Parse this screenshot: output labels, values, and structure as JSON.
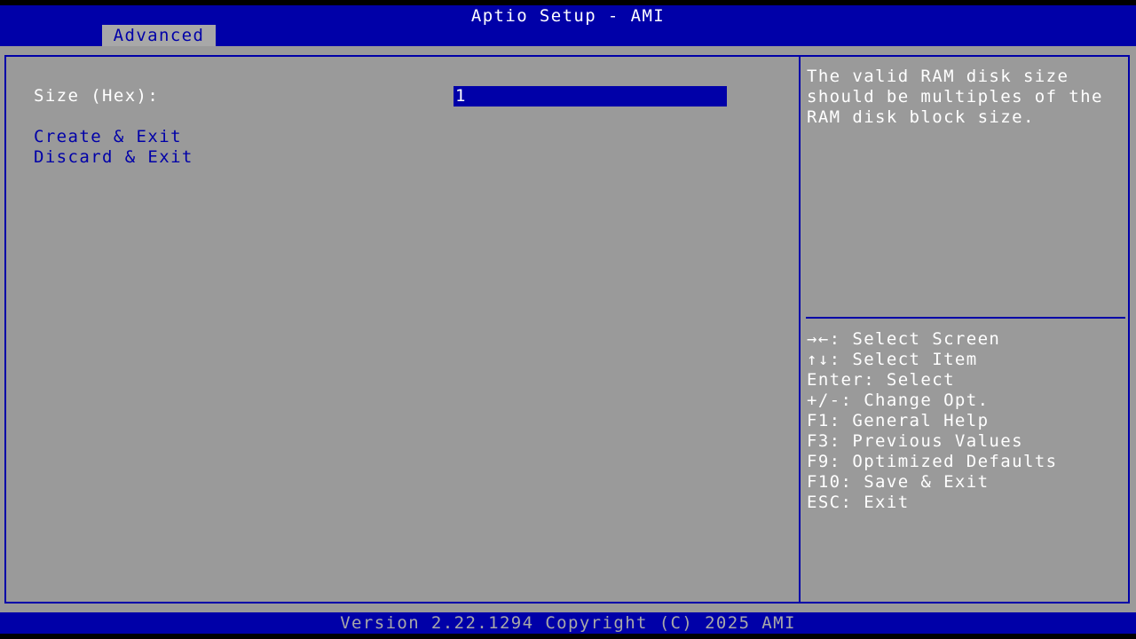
{
  "header": {
    "title": "Aptio Setup - AMI",
    "active_tab": "Advanced"
  },
  "form": {
    "size_label": "Size (Hex):",
    "size_value": "1",
    "actions": [
      {
        "label": "Create & Exit"
      },
      {
        "label": "Discard & Exit"
      }
    ]
  },
  "help": {
    "text": "The valid RAM disk size\nshould be multiples of the\nRAM disk block size."
  },
  "keys": [
    {
      "text": "→←: Select Screen"
    },
    {
      "text": "↑↓: Select Item"
    },
    {
      "text": "Enter: Select"
    },
    {
      "text": "+/-: Change Opt."
    },
    {
      "text": "F1: General Help"
    },
    {
      "text": "F3: Previous Values"
    },
    {
      "text": "F9: Optimized Defaults"
    },
    {
      "text": "F10: Save & Exit"
    },
    {
      "text": "ESC: Exit"
    }
  ],
  "footer": {
    "version_text": "Version 2.22.1294 Copyright (C) 2025 AMI"
  },
  "colors": {
    "bios_blue": "#0000a8",
    "panel_gray": "#9a9a9a",
    "tab_gray": "#a8a8a8",
    "text_white": "#ffffff"
  }
}
